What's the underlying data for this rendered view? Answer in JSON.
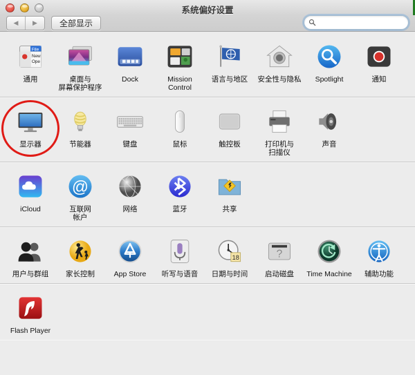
{
  "window": {
    "title": "系统偏好设置",
    "controls": [
      {
        "name": "close",
        "color": "#e0483c"
      },
      {
        "name": "minimize",
        "color": "#e0a321"
      },
      {
        "name": "zoom",
        "color": "#c2c2c2"
      }
    ]
  },
  "toolbar": {
    "back_label": "◀",
    "forward_label": "▶",
    "show_all_label": "全部显示",
    "search_value": "",
    "search_placeholder": ""
  },
  "annotation": {
    "color": "#e01b16",
    "target": "显示器"
  },
  "rows": [
    {
      "name": "personal",
      "items": [
        {
          "label": "通用",
          "icon": "general-icon"
        },
        {
          "label": "桌面与\n屏幕保护程序",
          "icon": "desktop-screensaver-icon"
        },
        {
          "label": "Dock",
          "icon": "dock-icon"
        },
        {
          "label": "Mission\nControl",
          "icon": "mission-control-icon"
        },
        {
          "label": "语言与地区",
          "icon": "language-region-icon"
        },
        {
          "label": "安全性与隐私",
          "icon": "security-privacy-icon"
        },
        {
          "label": "Spotlight",
          "icon": "spotlight-icon"
        },
        {
          "label": "通知",
          "icon": "notifications-icon"
        }
      ]
    },
    {
      "name": "hardware",
      "items": [
        {
          "label": "显示器",
          "icon": "displays-icon"
        },
        {
          "label": "节能器",
          "icon": "energy-saver-icon"
        },
        {
          "label": "键盘",
          "icon": "keyboard-icon"
        },
        {
          "label": "鼠标",
          "icon": "mouse-icon"
        },
        {
          "label": "触控板",
          "icon": "trackpad-icon"
        },
        {
          "label": "打印机与\n扫描仪",
          "icon": "printers-scanners-icon"
        },
        {
          "label": "声音",
          "icon": "sound-icon"
        }
      ]
    },
    {
      "name": "internet-wireless",
      "items": [
        {
          "label": "iCloud",
          "icon": "icloud-icon"
        },
        {
          "label": "互联网\n帐户",
          "icon": "internet-accounts-icon"
        },
        {
          "label": "网络",
          "icon": "network-icon"
        },
        {
          "label": "蓝牙",
          "icon": "bluetooth-icon"
        },
        {
          "label": "共享",
          "icon": "sharing-icon"
        }
      ]
    },
    {
      "name": "system",
      "items": [
        {
          "label": "用户与群组",
          "icon": "users-groups-icon"
        },
        {
          "label": "家长控制",
          "icon": "parental-controls-icon"
        },
        {
          "label": "App Store",
          "icon": "app-store-icon"
        },
        {
          "label": "听写与语音",
          "icon": "dictation-speech-icon"
        },
        {
          "label": "日期与时间",
          "icon": "date-time-icon",
          "badge": "18"
        },
        {
          "label": "启动磁盘",
          "icon": "startup-disk-icon"
        },
        {
          "label": "Time Machine",
          "icon": "time-machine-icon"
        },
        {
          "label": "辅助功能",
          "icon": "accessibility-icon"
        }
      ]
    },
    {
      "name": "other",
      "items": [
        {
          "label": "Flash Player",
          "icon": "flash-player-icon"
        }
      ]
    }
  ]
}
